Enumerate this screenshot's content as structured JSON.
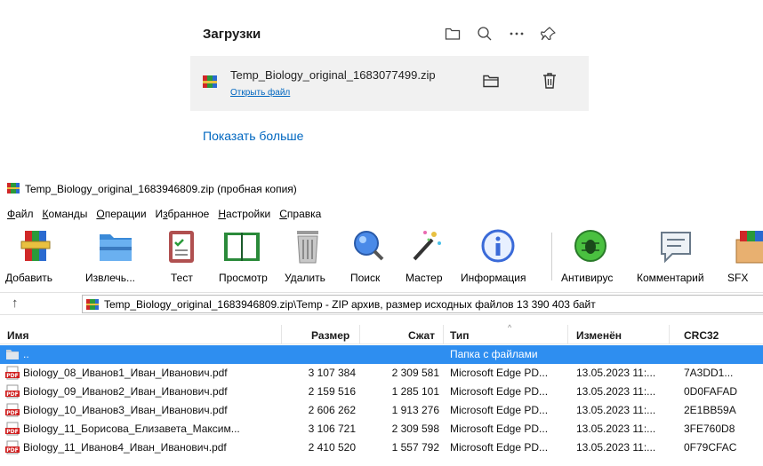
{
  "downloads": {
    "title": "Загрузки",
    "item": {
      "filename": "Temp_Biology_original_1683077499.zip",
      "open_link": "Открыть файл"
    },
    "show_more": "Показать больше",
    "icons": [
      "folder-icon",
      "search-icon",
      "more-icon",
      "pin-icon"
    ]
  },
  "window": {
    "title": "Temp_Biology_original_1683946809.zip (пробная копия)"
  },
  "menu": [
    {
      "u": "Ф",
      "rest": "айл"
    },
    {
      "u": "К",
      "rest": "оманды"
    },
    {
      "u": "О",
      "rest": "перации"
    },
    {
      "pre": "И",
      "u": "з",
      "rest": "бранное"
    },
    {
      "u": "Н",
      "rest": "астройки"
    },
    {
      "u": "С",
      "rest": "правка"
    }
  ],
  "toolbar": {
    "add": "Добавить",
    "extract": "Извлечь...",
    "test": "Тест",
    "view": "Просмотр",
    "delete": "Удалить",
    "find": "Поиск",
    "wizard": "Мастер",
    "info": "Информация",
    "antivirus": "Антивирус",
    "comment": "Комментарий",
    "sfx": "SFX"
  },
  "address": {
    "path": "Temp_Biology_original_1683946809.zip\\Temp - ZIP архив, размер исходных файлов 13 390 403 байт"
  },
  "columns": {
    "name": "Имя",
    "size": "Размер",
    "packed": "Сжат",
    "type": "Тип",
    "modified": "Изменён",
    "crc": "CRC32"
  },
  "files": [
    {
      "name": "..",
      "size": "",
      "packed": "",
      "type": "Папка с файлами",
      "modified": "",
      "crc": ""
    },
    {
      "name": "Biology_08_Иванов1_Иван_Иванович.pdf",
      "size": "3 107 384",
      "packed": "2 309 581",
      "type": "Microsoft Edge PD...",
      "modified": "13.05.2023 11:...",
      "crc": "7A3DD1..."
    },
    {
      "name": "Biology_09_Иванов2_Иван_Иванович.pdf",
      "size": "2 159 516",
      "packed": "1 285 101",
      "type": "Microsoft Edge PD...",
      "modified": "13.05.2023 11:...",
      "crc": "0D0FAFAD"
    },
    {
      "name": "Biology_10_Иванов3_Иван_Иванович.pdf",
      "size": "2 606 262",
      "packed": "1 913 276",
      "type": "Microsoft Edge PD...",
      "modified": "13.05.2023 11:...",
      "crc": "2E1BB59A"
    },
    {
      "name": "Biology_11_Борисова_Елизавета_Максим...",
      "size": "3 106 721",
      "packed": "2 309 598",
      "type": "Microsoft Edge PD...",
      "modified": "13.05.2023 11:...",
      "crc": "3FE760D8"
    },
    {
      "name": "Biology_11_Иванов4_Иван_Иванович.pdf",
      "size": "2 410 520",
      "packed": "1 557 792",
      "type": "Microsoft Edge PD...",
      "modified": "13.05.2023 11:...",
      "crc": "0F79CFAC"
    }
  ]
}
